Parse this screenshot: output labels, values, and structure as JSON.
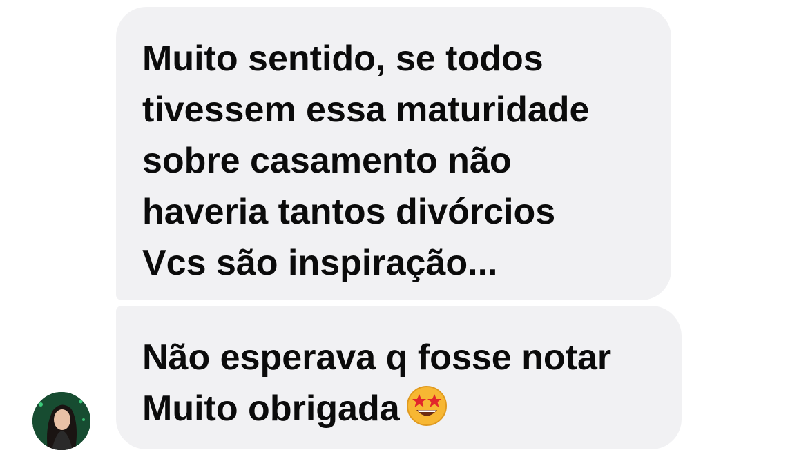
{
  "messages": [
    {
      "lines": [
        "Muito sentido, se todos",
        "tivessem essa maturidade",
        "sobre casamento não",
        "haveria tantos divórcios",
        "Vcs são inspiração..."
      ]
    },
    {
      "lines": [
        "Não esperava q fosse notar",
        "Muito obrigada"
      ],
      "emoji": "star-struck-emoji"
    }
  ],
  "colors": {
    "bubble_bg": "#f1f1f3",
    "text": "#0b0b0b",
    "emoji_face": "#f7b733",
    "avatar_bg": "#1f5a3a"
  },
  "avatar": {
    "icon": "profile-avatar"
  }
}
